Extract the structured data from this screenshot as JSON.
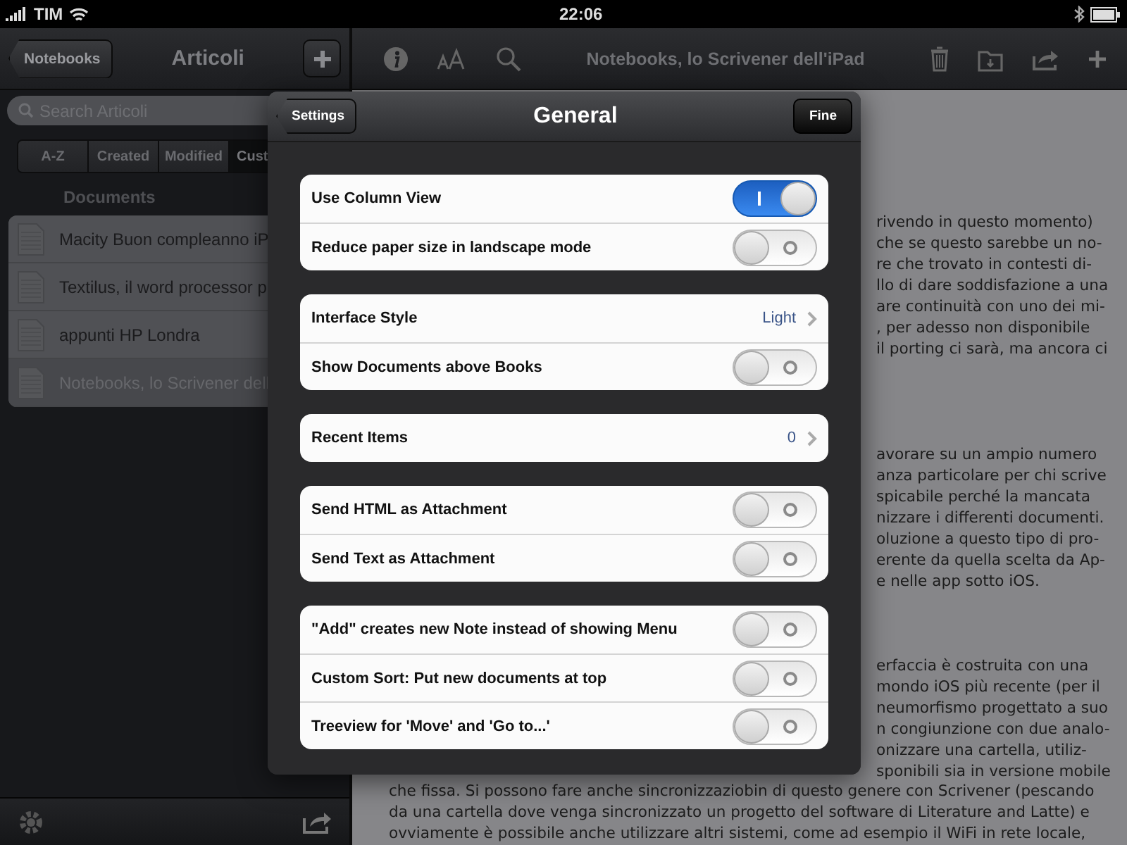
{
  "status_bar": {
    "carrier": "TIM",
    "time": "22:06"
  },
  "sidebar": {
    "back_button": "Notebooks",
    "title": "Articoli",
    "search": {
      "placeholder": "Search Articoli"
    },
    "sort_tabs": [
      {
        "label": "A-Z",
        "selected": false
      },
      {
        "label": "Created",
        "selected": false
      },
      {
        "label": "Modified",
        "selected": false
      },
      {
        "label": "Cust",
        "selected": true
      }
    ],
    "section_header": "Documents",
    "documents": [
      {
        "title": "Macity Buon compleanno iP",
        "selected": false
      },
      {
        "title": "Textilus, il word processor p",
        "selected": false
      },
      {
        "title": "appunti HP Londra",
        "selected": false
      },
      {
        "title": "Notebooks, lo Scrivener dell",
        "selected": true
      }
    ]
  },
  "toolbar": {
    "title": "Notebooks, lo Scrivener dell'iPad"
  },
  "document": {
    "paragraphs": [
      {
        "lines": [
          "rivendo in questo momento)",
          "che se questo sarebbe un no-",
          "re che trovato in contesti di-",
          "llo di dare soddisfazione a una",
          "are continuità con uno dei mi-",
          ", per adesso non disponibile",
          "il porting ci sarà, ma ancora ci"
        ]
      },
      {
        "lines": [
          "avorare su un ampio numero",
          "anza particolare per chi scrive",
          "spicabile perché la mancata",
          "nizzare i differenti documenti.",
          "oluzione a questo tipo di pro-",
          "erente da quella scelta da Ap-",
          "e nelle app sotto iOS."
        ]
      },
      {
        "lines": [
          "erfaccia è costruita con una",
          "mondo iOS più recente (per il",
          "neumorfismo progettato a suo",
          "n congiunzione con due analo-",
          "onizzare una cartella, utiliz-",
          "sponibili sia in versione mobile"
        ]
      }
    ],
    "full_lines": [
      "che fissa. Si possono fare anche sincronizzaziobin di questo genere con Scrivener (pescando",
      "da una cartella dove venga sincronizzato un progetto del software di Literature and Latte) e",
      "ovviamente è possibile anche utilizzare altri sistemi, come ad esempio il WiFi in rete locale,"
    ]
  },
  "popover": {
    "back_button": "Settings",
    "title": "General",
    "done_button": "Fine",
    "groups": [
      [
        {
          "label": "Use Column View",
          "kind": "toggle",
          "on": true
        },
        {
          "label": "Reduce paper size in landscape mode",
          "kind": "toggle",
          "on": false
        }
      ],
      [
        {
          "label": "Interface Style",
          "kind": "disclosure",
          "value": "Light"
        },
        {
          "label": "Show Documents above Books",
          "kind": "toggle",
          "on": false
        }
      ],
      [
        {
          "label": "Recent Items",
          "kind": "disclosure",
          "value": "0"
        }
      ],
      [
        {
          "label": "Send HTML as Attachment",
          "kind": "toggle",
          "on": false
        },
        {
          "label": "Send Text as Attachment",
          "kind": "toggle",
          "on": false
        }
      ],
      [
        {
          "label": "\"Add\" creates new Note instead of showing Menu",
          "kind": "toggle",
          "on": false
        },
        {
          "label": "Custom Sort: Put new documents at top",
          "kind": "toggle",
          "on": false
        },
        {
          "label": "Treeview for 'Move' and 'Go to...'",
          "kind": "toggle",
          "on": false
        }
      ]
    ]
  }
}
